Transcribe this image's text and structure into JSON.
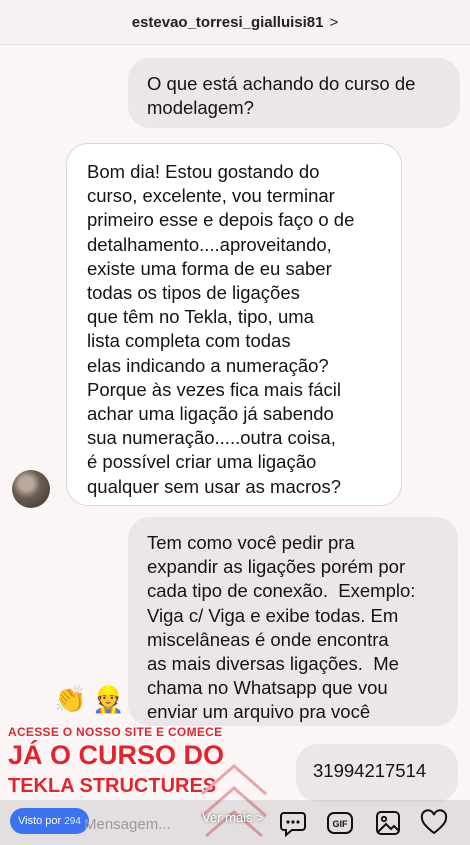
{
  "header": {
    "username": "estevao_torresi_gialluisi81",
    "chevron": ">"
  },
  "messages": [
    {
      "side": "sent",
      "text": "O que está achando do curso de\nmodelagem?"
    },
    {
      "side": "received",
      "text": "Bom dia! Estou gostando do\ncurso, excelente, vou terminar\nprimeiro esse e depois faço o de\ndetalhamento....aproveitando,\nexiste uma forma de eu saber\ntodas os tipos de ligações\nque têm no Tekla, tipo, uma\nlista completa com todas\nelas indicando a numeração?\nPorque às vezes fica mais fácil\nachar uma ligação já sabendo\nsua numeração.....outra coisa,\né possível criar uma ligação\nqualquer sem usar as macros?"
    },
    {
      "side": "sent",
      "text": "Tem como você pedir pra\nexpandir as ligações porém por\ncada tipo de conexão.  Exemplo:\nViga c/ Viga e exibe todas. Em\nmiscelâneas é onde encontra\nas mais diversas ligações.  Me\nchama no Whatsapp que vou\nenviar um arquivo pra você"
    },
    {
      "side": "sent",
      "text": "31994217514"
    }
  ],
  "promo": {
    "emojis": [
      "👏",
      "👷"
    ],
    "line1": "ACESSE O NOSSO SITE E COMECE",
    "line2": "JÁ O CURSO DO",
    "line3": "TEKLA STRUCTURES",
    "color": "#e8212a"
  },
  "footer": {
    "viewers_label": "Visto por",
    "viewers_count": "294",
    "message_placeholder": "Mensagem...",
    "see_more": "Ver mais",
    "see_more_arrow": ">",
    "icons": [
      "chat-bubble-icon",
      "gif-icon",
      "image-icon",
      "heart-icon"
    ],
    "gif_label": "GIF"
  }
}
